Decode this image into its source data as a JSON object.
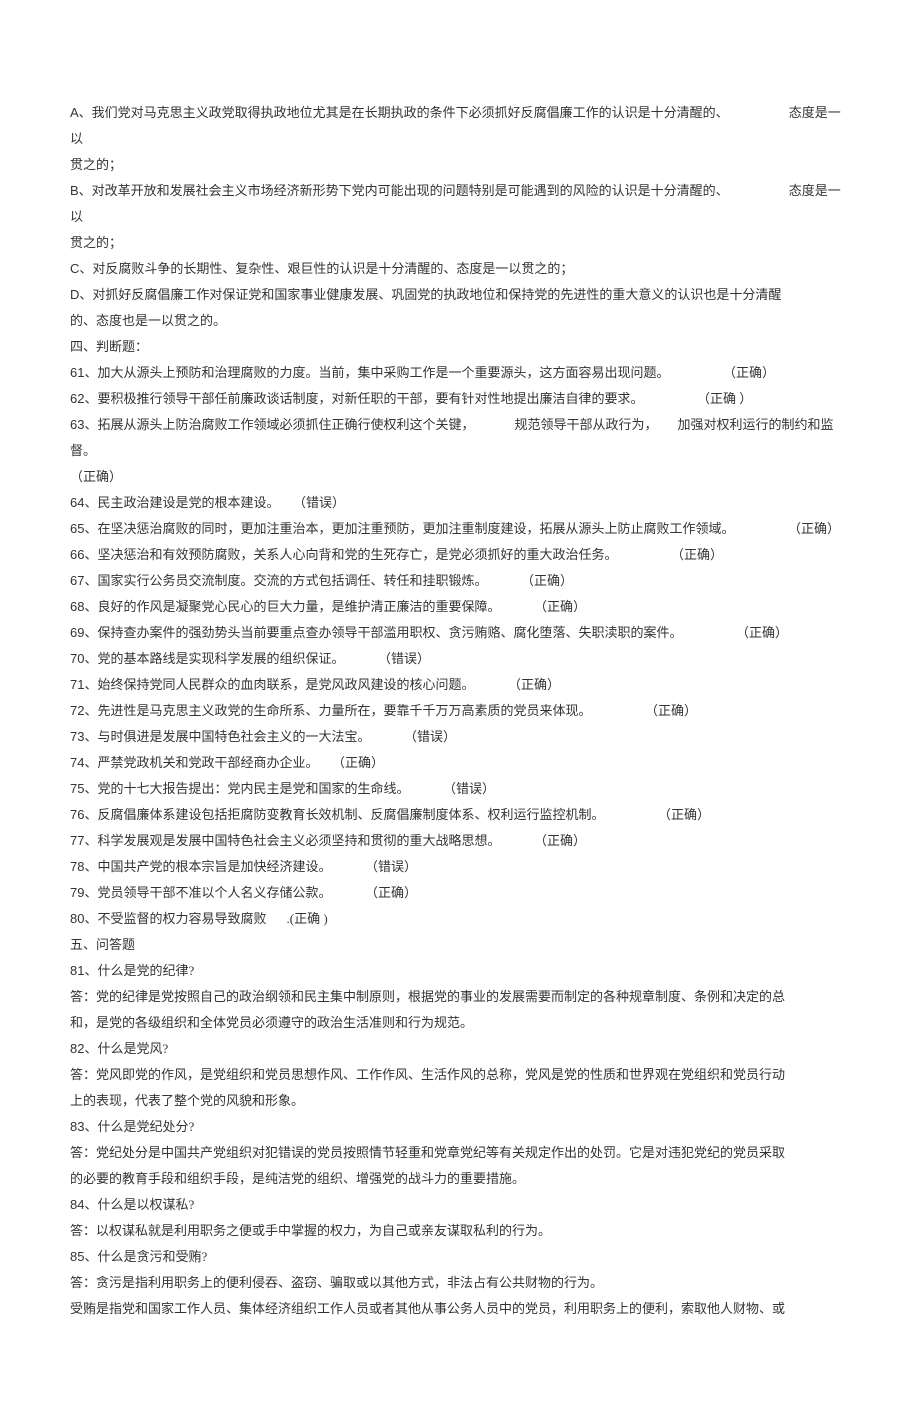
{
  "lines": [
    {
      "parts": [
        {
          "t": "A、我们党对马克思主义政党取得执政地位尤其是在长期执政的条件下必须抓好反腐倡廉工作的认识是十分清醒的、",
          "gap": "gap-large"
        },
        {
          "t": "态度是一以"
        }
      ]
    },
    {
      "parts": [
        {
          "t": "贯之的；"
        }
      ]
    },
    {
      "parts": [
        {
          "t": "B、对改革开放和发展社会主义市场经济新形势下党内可能出现的问题特别是可能遇到的风险的认识是十分清醒的、",
          "gap": "gap-large"
        },
        {
          "t": "态度是一以"
        }
      ]
    },
    {
      "parts": [
        {
          "t": "贯之的；"
        }
      ]
    },
    {
      "parts": [
        {
          "t": "C、对反腐败斗争的长期性、复杂性、艰巨性的认识是十分清醒的、态度是一以贯之的；"
        }
      ]
    },
    {
      "parts": [
        {
          "t": "D、对抓好反腐倡廉工作对保证党和国家事业健康发展、巩固党的执政地位和保持党的先进性的重大意义的认识也是十分清醒"
        }
      ]
    },
    {
      "parts": [
        {
          "t": "的、态度也是一以贯之的。"
        }
      ]
    },
    {
      "parts": [
        {
          "t": "四、判断题："
        }
      ]
    },
    {
      "parts": [
        {
          "t": "61、加大从源头上预防和治理腐败的力度。当前，集中采购工作是一个重要源头，这方面容易出现问题。",
          "gap": "gap-large"
        },
        {
          "t": "（正确）"
        }
      ]
    },
    {
      "parts": [
        {
          "t": "62、要积极推行领导干部任前廉政谈话制度，对新任职的干部，要有针对性地提出廉洁自律的要求。",
          "gap": "gap-large"
        },
        {
          "t": "（正确   ）"
        }
      ]
    },
    {
      "parts": [
        {
          "t": "63、拓展从源头上防治腐败工作领域必须抓住正确行使权利这个关键，",
          "gap": "gap-med"
        },
        {
          "t": "规范领导干部从政行为，",
          "gap": "gap-small"
        },
        {
          "t": "加强对权利运行的制约和监督。"
        }
      ]
    },
    {
      "parts": [
        {
          "t": "（正确）"
        }
      ]
    },
    {
      "parts": [
        {
          "t": "64、民主政治建设是党的根本建设。",
          "gap": "gap-small"
        },
        {
          "t": "（错误）"
        }
      ]
    },
    {
      "parts": [
        {
          "t": "65、在坚决惩治腐败的同时，更加注重治本，更加注重预防，更加注重制度建设，拓展从源头上防止腐败工作领域。",
          "gap": "gap-large"
        },
        {
          "t": "（正确）"
        }
      ]
    },
    {
      "parts": [
        {
          "t": "66、坚决惩治和有效预防腐败，关系人心向背和党的生死存亡，是党必须抓好的重大政治任务。",
          "gap": "gap-large"
        },
        {
          "t": "（正确）"
        }
      ]
    },
    {
      "parts": [
        {
          "t": "67、国家实行公务员交流制度。交流的方式包括调任、转任和挂职锻炼。",
          "gap": "gap-med"
        },
        {
          "t": "（正确）"
        }
      ]
    },
    {
      "parts": [
        {
          "t": "68、良好的作风是凝聚党心民心的巨大力量，是维护清正廉洁的重要保障。",
          "gap": "gap-med"
        },
        {
          "t": "（正确）"
        }
      ]
    },
    {
      "parts": [
        {
          "t": "69、保持查办案件的强劲势头当前要重点查办领导干部滥用职权、贪污贿赂、腐化堕落、失职渎职的案件。",
          "gap": "gap-large"
        },
        {
          "t": "（正确）"
        }
      ]
    },
    {
      "parts": [
        {
          "t": "70、党的基本路线是实现科学发展的组织保证。",
          "gap": "gap-med"
        },
        {
          "t": "（错误）"
        }
      ]
    },
    {
      "parts": [
        {
          "t": "71、始终保持党同人民群众的血肉联系，是党风政风建设的核心问题。",
          "gap": "gap-med"
        },
        {
          "t": "（正确）"
        }
      ]
    },
    {
      "parts": [
        {
          "t": "72、先进性是马克思主义政党的生命所系、力量所在，要靠千千万万高素质的党员来体现。",
          "gap": "gap-large"
        },
        {
          "t": "（正确）"
        }
      ]
    },
    {
      "parts": [
        {
          "t": "73、与时俱进是发展中国特色社会主义的一大法宝。",
          "gap": "gap-med"
        },
        {
          "t": "（错误）"
        }
      ]
    },
    {
      "parts": [
        {
          "t": "74、严禁党政机关和党政干部经商办企业。",
          "gap": "gap-small"
        },
        {
          "t": "（正确）"
        }
      ]
    },
    {
      "parts": [
        {
          "t": "75、党的十七大报告提出：党内民主是党和国家的生命线。",
          "gap": "gap-med"
        },
        {
          "t": "（错误）"
        }
      ]
    },
    {
      "parts": [
        {
          "t": "76、反腐倡廉体系建设包括拒腐防变教育长效机制、反腐倡廉制度体系、权利运行监控机制。",
          "gap": "gap-large"
        },
        {
          "t": "（正确）"
        }
      ]
    },
    {
      "parts": [
        {
          "t": "77、科学发展观是发展中国特色社会主义必须坚持和贯彻的重大战略思想。",
          "gap": "gap-med"
        },
        {
          "t": "（正确）"
        }
      ]
    },
    {
      "parts": [
        {
          "t": "78、中国共产党的根本宗旨是加快经济建设。",
          "gap": "gap-med"
        },
        {
          "t": "（错误）"
        }
      ]
    },
    {
      "parts": [
        {
          "t": "79、党员领导干部不准以个人名义存储公款。",
          "gap": "gap-med"
        },
        {
          "t": "（正确）"
        }
      ]
    },
    {
      "parts": [
        {
          "t": "80、不受监督的权力容易导致腐败",
          "gap": "gap-small"
        },
        {
          "t": ".(正确 )"
        }
      ]
    },
    {
      "parts": [
        {
          "t": "五、问答题"
        }
      ]
    },
    {
      "parts": [
        {
          "t": "81、什么是党的纪律?"
        }
      ]
    },
    {
      "parts": [
        {
          "t": "答：党的纪律是党按照自己的政治纲领和民主集中制原则，根据党的事业的发展需要而制定的各种规章制度、条例和决定的总"
        }
      ]
    },
    {
      "parts": [
        {
          "t": "和，是党的各级组织和全体党员必须遵守的政治生活准则和行为规范。"
        }
      ]
    },
    {
      "parts": [
        {
          "t": "82、什么是党风?"
        }
      ]
    },
    {
      "parts": [
        {
          "t": "答：党风即党的作风，是党组织和党员思想作风、工作作风、生活作风的总称，党风是党的性质和世界观在党组织和党员行动"
        }
      ]
    },
    {
      "parts": [
        {
          "t": "上的表现，代表了整个党的风貌和形象。"
        }
      ]
    },
    {
      "parts": [
        {
          "t": "83、什么是党纪处分?"
        }
      ]
    },
    {
      "parts": [
        {
          "t": "答：党纪处分是中国共产党组织对犯错误的党员按照情节轻重和党章党纪等有关规定作出的处罚。它是对违犯党纪的党员采取"
        }
      ]
    },
    {
      "parts": [
        {
          "t": "的必要的教育手段和组织手段，是纯洁党的组织、增强党的战斗力的重要措施。"
        }
      ]
    },
    {
      "parts": [
        {
          "t": "84、什么是以权谋私?"
        }
      ]
    },
    {
      "parts": [
        {
          "t": "答：以权谋私就是利用职务之便或手中掌握的权力，为自己或亲友谋取私利的行为。"
        }
      ]
    },
    {
      "parts": [
        {
          "t": "85、什么是贪污和受贿?"
        }
      ]
    },
    {
      "parts": [
        {
          "t": "答：贪污是指利用职务上的便利侵吞、盗窃、骗取或以其他方式，非法占有公共财物的行为。"
        }
      ]
    },
    {
      "parts": [
        {
          "t": "受贿是指党和国家工作人员、集体经济组织工作人员或者其他从事公务人员中的党员，利用职务上的便利，索取他人财物、或"
        }
      ]
    }
  ]
}
